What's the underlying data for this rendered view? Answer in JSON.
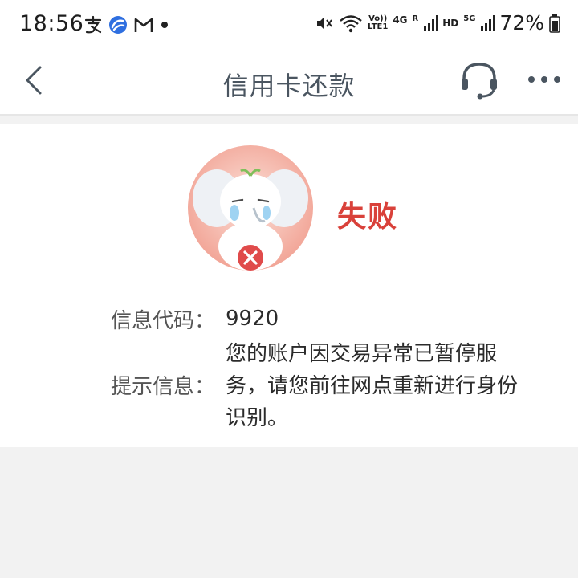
{
  "status_bar": {
    "time": "18:56",
    "battery_percent": "72%",
    "network_labels": {
      "volte": "Vo))",
      "lte": "LTE1",
      "four_g": "4G",
      "roaming": "R",
      "hd": "HD",
      "five_g": "5G"
    },
    "left_icons": [
      "alipay-icon",
      "app-swirl-icon",
      "gmail-icon",
      "notification-dot-icon"
    ],
    "right_icons": [
      "mute-icon",
      "wifi-icon",
      "signal-icon",
      "battery-icon"
    ]
  },
  "nav": {
    "title": "信用卡还款",
    "icons": [
      "back-icon",
      "customer-service-icon",
      "more-icon"
    ]
  },
  "result": {
    "status": "失败",
    "status_color": "#d9413a",
    "code_label": "信息代码：",
    "code_value": "9920",
    "tip_label": "提示信息：",
    "tip_value": "您的账户因交易异常已暂停服务，请您前往网点重新进行身份识别。"
  }
}
